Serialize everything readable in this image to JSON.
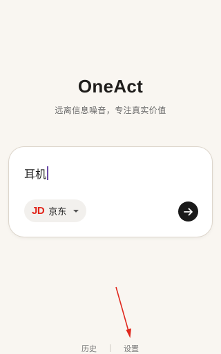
{
  "app": {
    "title": "OneAct",
    "subtitle": "远离信息噪音，专注真实价值"
  },
  "search": {
    "query": "耳机"
  },
  "store": {
    "logo_text": "JD",
    "label": "京东",
    "logo_color": "#e1251b"
  },
  "footer": {
    "history_label": "历史",
    "settings_label": "设置"
  },
  "annotation": {
    "arrow_color": "#e0281e"
  },
  "colors": {
    "background": "#f9f6f1",
    "accent_dark": "#1a1a1a"
  }
}
